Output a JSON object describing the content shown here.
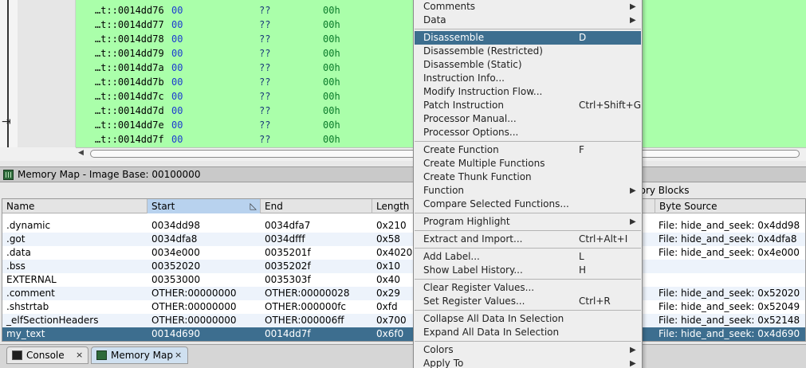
{
  "listing": {
    "rows": [
      {
        "addr": "…t::0014dd76",
        "byte": "00",
        "mnem": "??",
        "oper": "00h"
      },
      {
        "addr": "…t::0014dd77",
        "byte": "00",
        "mnem": "??",
        "oper": "00h"
      },
      {
        "addr": "…t::0014dd78",
        "byte": "00",
        "mnem": "??",
        "oper": "00h"
      },
      {
        "addr": "…t::0014dd79",
        "byte": "00",
        "mnem": "??",
        "oper": "00h"
      },
      {
        "addr": "…t::0014dd7a",
        "byte": "00",
        "mnem": "??",
        "oper": "00h"
      },
      {
        "addr": "…t::0014dd7b",
        "byte": "00",
        "mnem": "??",
        "oper": "00h"
      },
      {
        "addr": "…t::0014dd7c",
        "byte": "00",
        "mnem": "??",
        "oper": "00h"
      },
      {
        "addr": "…t::0014dd7d",
        "byte": "00",
        "mnem": "??",
        "oper": "00h"
      },
      {
        "addr": "…t::0014dd7e",
        "byte": "00",
        "mnem": "??",
        "oper": "00h"
      },
      {
        "addr": "…t::0014dd7f",
        "byte": "00",
        "mnem": "??",
        "oper": "00h"
      }
    ]
  },
  "memory_map": {
    "title": "Memory Map - Image Base: 00100000",
    "blocks_title": "nory Blocks",
    "columns": {
      "name": "Name",
      "start": "Start",
      "end": "End",
      "length": "Length",
      "byte_source": "Byte Source"
    },
    "rows": [
      {
        "name": ".dynamic",
        "start": "0034dd98",
        "end": "0034dfa7",
        "length": "0x210",
        "source": "File: hide_and_seek: 0x4dd98"
      },
      {
        "name": ".got",
        "start": "0034dfa8",
        "end": "0034dfff",
        "length": "0x58",
        "source": "File: hide_and_seek: 0x4dfa8"
      },
      {
        "name": ".data",
        "start": "0034e000",
        "end": "0035201f",
        "length": "0x4020",
        "source": "File: hide_and_seek: 0x4e000"
      },
      {
        "name": ".bss",
        "start": "00352020",
        "end": "0035202f",
        "length": "0x10",
        "source": ""
      },
      {
        "name": "EXTERNAL",
        "start": "00353000",
        "end": "0035303f",
        "length": "0x40",
        "source": ""
      },
      {
        "name": ".comment",
        "start": "OTHER:00000000",
        "end": "OTHER:00000028",
        "length": "0x29",
        "source": "File: hide_and_seek: 0x52020"
      },
      {
        "name": ".shstrtab",
        "start": "OTHER:00000000",
        "end": "OTHER:000000fc",
        "length": "0xfd",
        "source": "File: hide_and_seek: 0x52049"
      },
      {
        "name": "_elfSectionHeaders",
        "start": "OTHER:00000000",
        "end": "OTHER:000006ff",
        "length": "0x700",
        "source": "File: hide_and_seek: 0x52148"
      },
      {
        "name": "my_text",
        "start": "0014d690",
        "end": "0014dd7f",
        "length": "0x6f0",
        "source": "File: hide_and_seek: 0x4d690"
      }
    ]
  },
  "tabs": [
    {
      "label": "Console",
      "close": "×"
    },
    {
      "label": "Memory Map",
      "close": "×"
    }
  ],
  "context_menu": {
    "items": [
      {
        "label": "Comments",
        "accel": "",
        "submenu": true
      },
      {
        "label": "Data",
        "accel": "",
        "submenu": true
      },
      {
        "label": "Disassemble",
        "accel": "D",
        "submenu": false,
        "highlighted": true
      },
      {
        "label": "Disassemble (Restricted)",
        "accel": "",
        "submenu": false
      },
      {
        "label": "Disassemble (Static)",
        "accel": "",
        "submenu": false
      },
      {
        "label": "Instruction Info...",
        "accel": "",
        "submenu": false
      },
      {
        "label": "Modify Instruction Flow...",
        "accel": "",
        "submenu": false
      },
      {
        "label": "Patch Instruction",
        "accel": "Ctrl+Shift+G",
        "submenu": false
      },
      {
        "label": "Processor Manual...",
        "accel": "",
        "submenu": false
      },
      {
        "label": "Processor Options...",
        "accel": "",
        "submenu": false
      },
      {
        "label": "Create Function",
        "accel": "F",
        "submenu": false
      },
      {
        "label": "Create Multiple Functions",
        "accel": "",
        "submenu": false
      },
      {
        "label": "Create Thunk Function",
        "accel": "",
        "submenu": false
      },
      {
        "label": "Function",
        "accel": "",
        "submenu": true
      },
      {
        "label": "Compare Selected Functions...",
        "accel": "",
        "submenu": false
      },
      {
        "label": "Program Highlight",
        "accel": "",
        "submenu": true
      },
      {
        "label": "Extract and Import...",
        "accel": "Ctrl+Alt+I",
        "submenu": false
      },
      {
        "label": "Add Label...",
        "accel": "L",
        "submenu": false
      },
      {
        "label": "Show Label History...",
        "accel": "H",
        "submenu": false
      },
      {
        "label": "Clear Register Values...",
        "accel": "",
        "submenu": false
      },
      {
        "label": "Set Register Values...",
        "accel": "Ctrl+R",
        "submenu": false
      },
      {
        "label": "Collapse All Data In Selection",
        "accel": "",
        "submenu": false
      },
      {
        "label": "Expand All Data In Selection",
        "accel": "",
        "submenu": false
      },
      {
        "label": "Colors",
        "accel": "",
        "submenu": true
      },
      {
        "label": "Apply To",
        "accel": "",
        "submenu": true
      }
    ],
    "submenu_glyph": "▶"
  },
  "icons": {
    "sort": "sort-icon",
    "window": "memory-map-window-icon",
    "console": "console-icon",
    "memory_map_tab": "memory-map-icon"
  },
  "colors": {
    "listing_bg": "#aaffaa",
    "selection": "#3d6e8f",
    "byte_blue": "#1c3bd0"
  }
}
